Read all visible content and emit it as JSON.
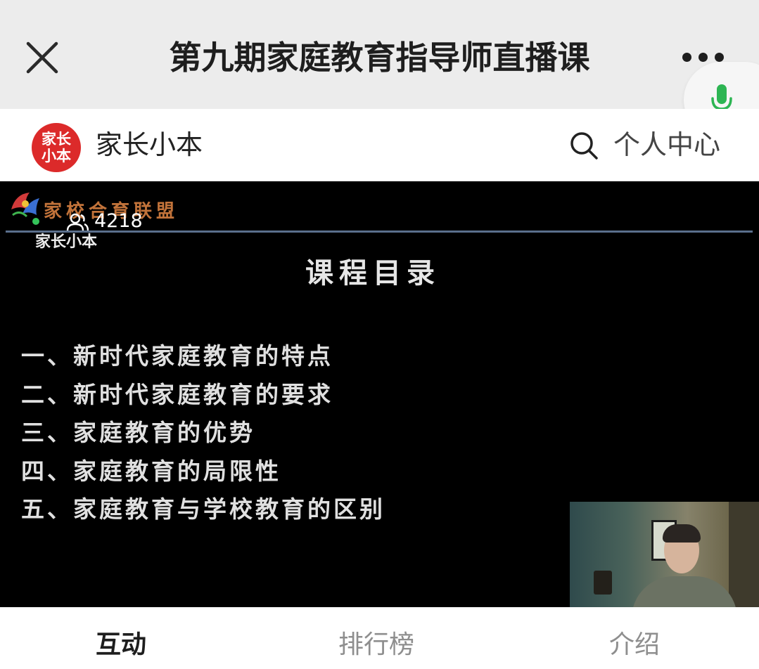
{
  "header": {
    "title": "第九期家庭教育指导师直播课"
  },
  "app": {
    "logo_text": "家长小本",
    "name": "家长小本",
    "personal_center": "个人中心"
  },
  "video": {
    "banner_text": "家校合育联盟",
    "viewer_count": "4218",
    "watermark": "家长小本",
    "slide": {
      "title": "课程目录",
      "items": [
        "一、新时代家庭教育的特点",
        "二、新时代家庭教育的要求",
        "三、家庭教育的优势",
        "四、家庭教育的局限性",
        "五、家庭教育与学校教育的区别"
      ]
    }
  },
  "tabs": [
    {
      "label": "互动",
      "active": true
    },
    {
      "label": "排行榜",
      "active": false
    },
    {
      "label": "介绍",
      "active": false
    }
  ],
  "colors": {
    "accent_red": "#dc2a2a",
    "mic_green": "#2db553",
    "live_green": "#34c35a"
  },
  "icons": [
    "close-icon",
    "more-icon",
    "microphone-icon",
    "search-icon",
    "viewers-icon"
  ]
}
